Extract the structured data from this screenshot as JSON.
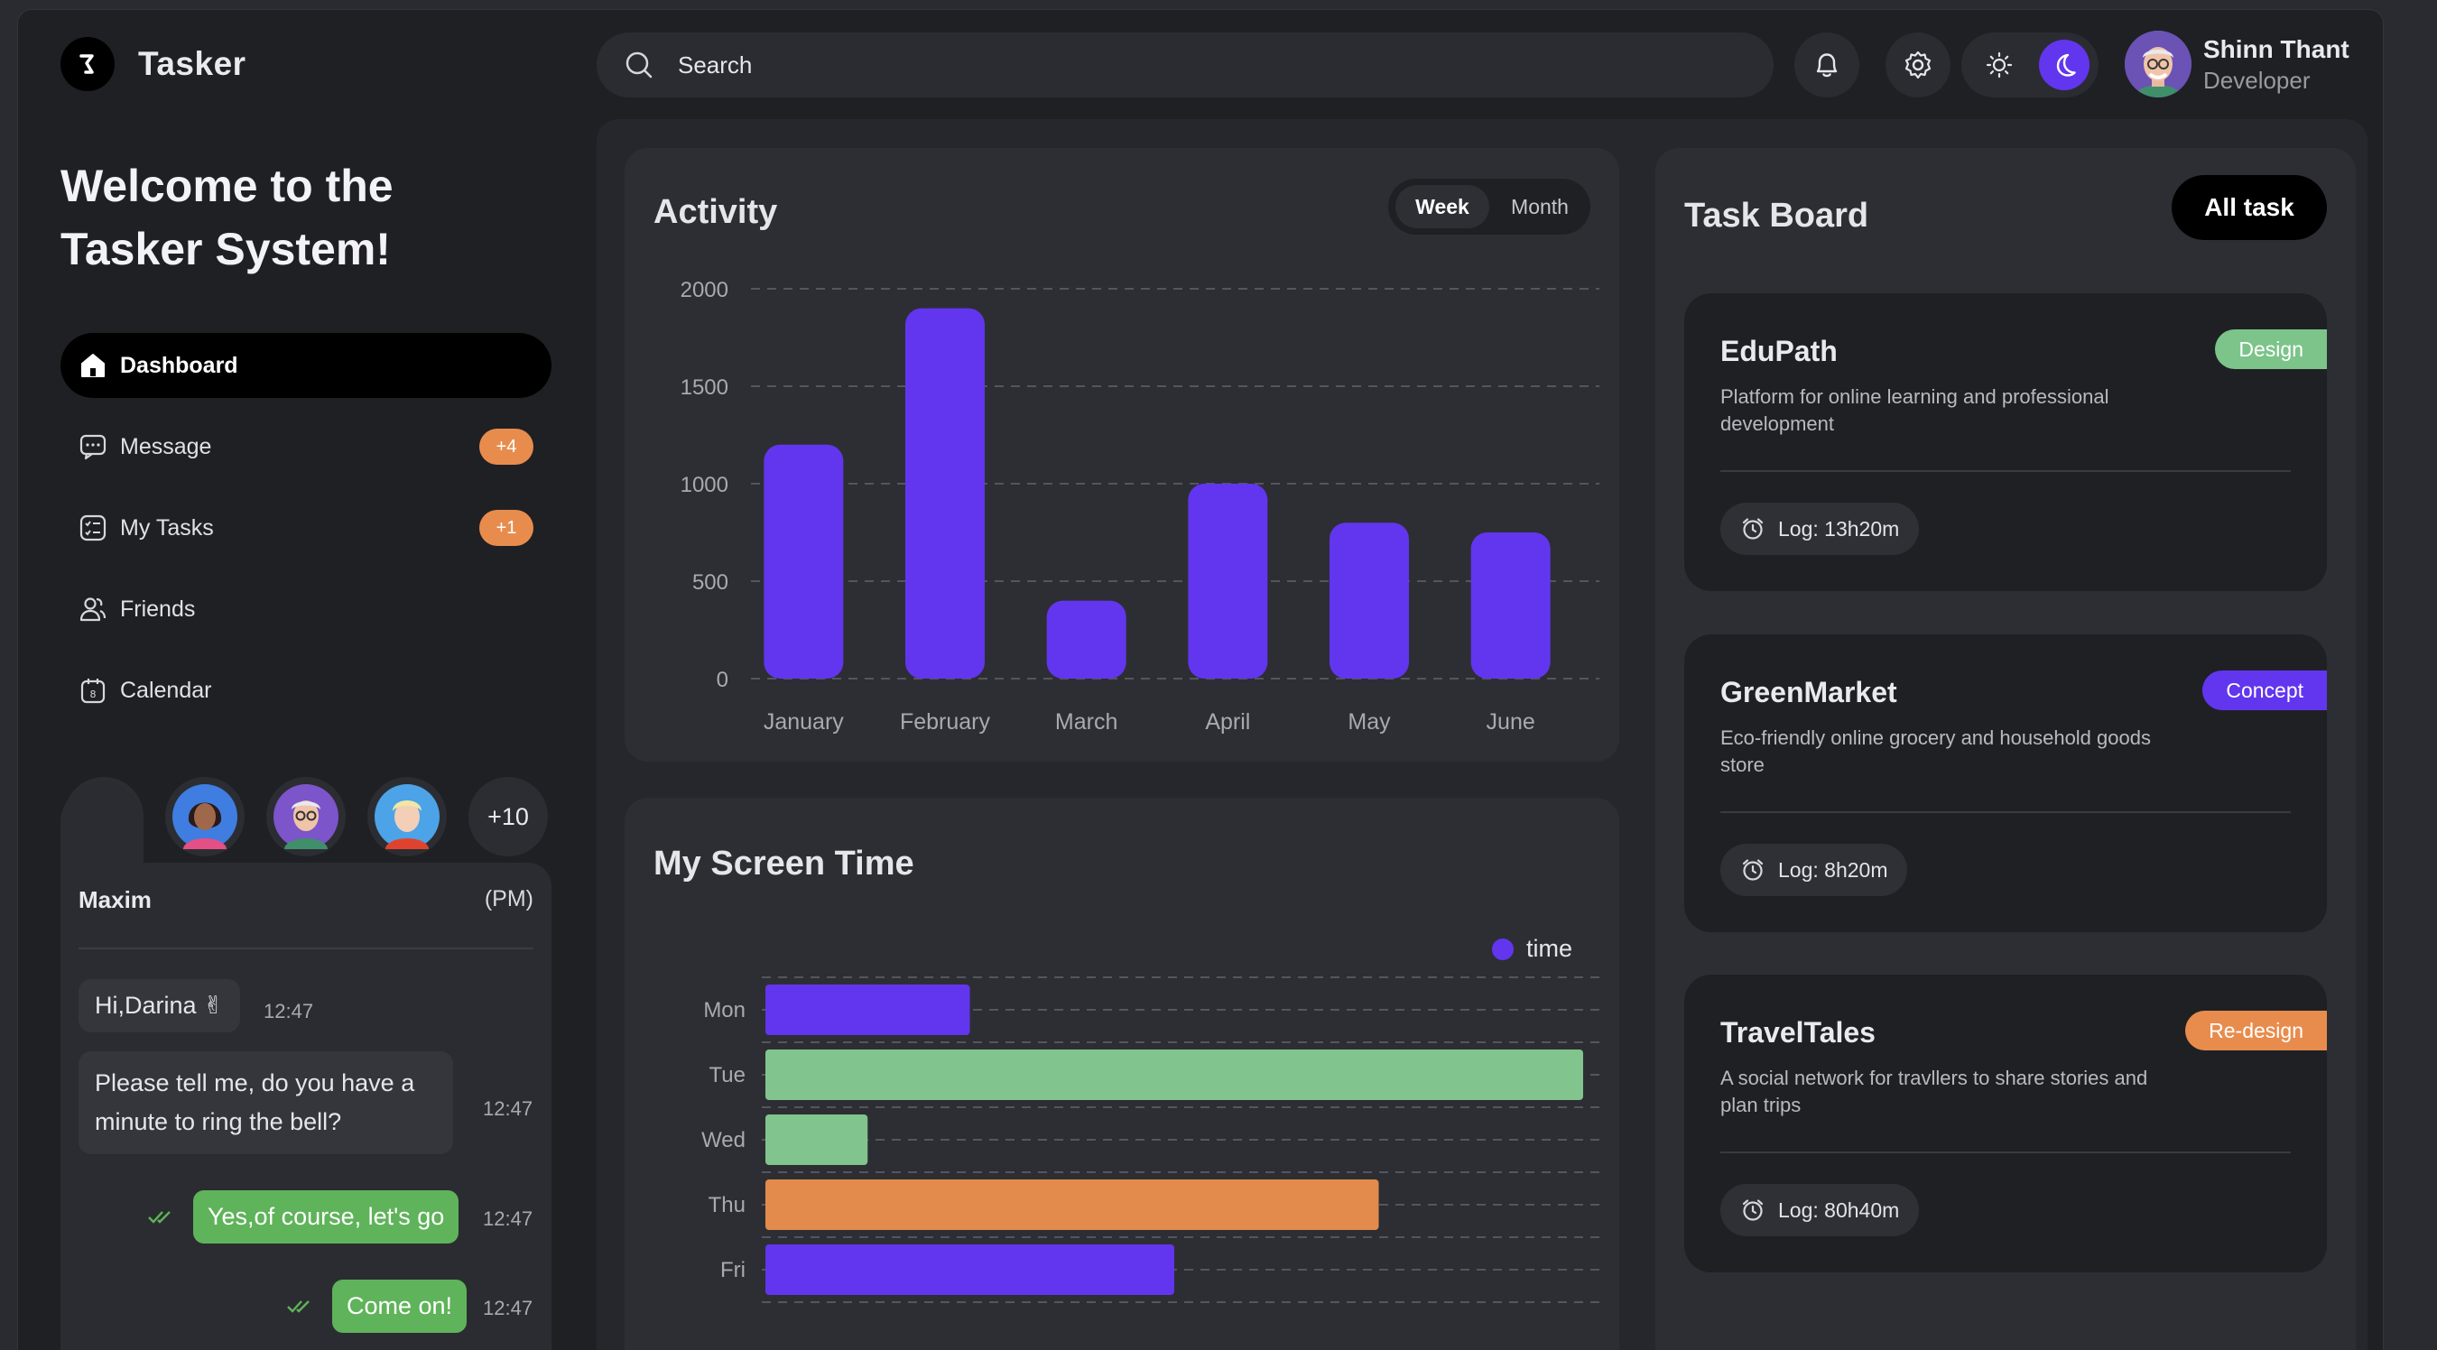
{
  "app": {
    "name": "Tasker"
  },
  "search": {
    "placeholder": "Search"
  },
  "user": {
    "name": "Shinn Thant",
    "role": "Developer"
  },
  "welcome": {
    "line1": "Welcome to the",
    "line2": "Tasker System!"
  },
  "nav": [
    {
      "label": "Dashboard",
      "icon": "home-icon",
      "active": true
    },
    {
      "label": "Message",
      "icon": "message-icon",
      "badge": "+4"
    },
    {
      "label": "My Tasks",
      "icon": "tasks-icon",
      "badge": "+1"
    },
    {
      "label": "Friends",
      "icon": "friends-icon"
    },
    {
      "label": "Calendar",
      "icon": "calendar-icon"
    }
  ],
  "friends": {
    "more": "+10"
  },
  "chat": {
    "name": "Maxim",
    "period": "(PM)",
    "messages": [
      {
        "text": "Hi,Darina ✌",
        "time": "12:47",
        "dir": "in"
      },
      {
        "text": "Please tell me, do you have a",
        "text2": "minute to ring the bell?",
        "time": "12:47",
        "dir": "in"
      },
      {
        "text": "Yes,of course, let's go",
        "time": "12:47",
        "dir": "out"
      },
      {
        "text": "Come on!",
        "time": "12:47",
        "dir": "out"
      }
    ]
  },
  "activity": {
    "title": "Activity",
    "toggle": {
      "week": "Week",
      "month": "Month"
    }
  },
  "screen_time": {
    "title": "My Screen Time",
    "legend": "time"
  },
  "task_board": {
    "title": "Task Board",
    "all_button": "All task",
    "tasks": [
      {
        "name": "EduPath",
        "desc": "Platform for online learning and professional development",
        "tag": "Design",
        "tag_color": "#7cc48a",
        "log": "Log: 13h20m"
      },
      {
        "name": "GreenMarket",
        "desc": "Eco-friendly online grocery and household goods store",
        "tag": "Concept",
        "tag_color": "#6236ee",
        "log": "Log: 8h20m"
      },
      {
        "name": "TravelTales",
        "desc": "A social network for travllers to share stories and plan trips",
        "tag": "Re-design",
        "tag_color": "#e88c4d",
        "log": "Log: 80h40m"
      }
    ]
  },
  "colors": {
    "accent": "#6236ee",
    "green": "#82c48d",
    "orange": "#e38b4c",
    "badge": "#e88c4d"
  },
  "chart_data": [
    {
      "type": "bar",
      "title": "Activity",
      "categories": [
        "January",
        "February",
        "March",
        "April",
        "May",
        "June"
      ],
      "values": [
        1200,
        1900,
        400,
        1000,
        800,
        750
      ],
      "ylim": [
        0,
        2000
      ],
      "yticks": [
        "2000",
        "1500",
        "1000",
        "500",
        "0"
      ],
      "grid": true
    },
    {
      "type": "bar",
      "orientation": "horizontal",
      "title": "My Screen Time",
      "categories": [
        "Mon",
        "Tue",
        "Wed",
        "Thu",
        "Fri"
      ],
      "series": [
        {
          "name": "time",
          "values": [
            2.5,
            10,
            1.25,
            7.5,
            5
          ]
        }
      ],
      "bar_colors": [
        "#6236ee",
        "#82c48d",
        "#82c48d",
        "#e38b4c",
        "#6236ee"
      ],
      "xlim": [
        0,
        10
      ],
      "legend": "top-right",
      "grid": true
    }
  ]
}
